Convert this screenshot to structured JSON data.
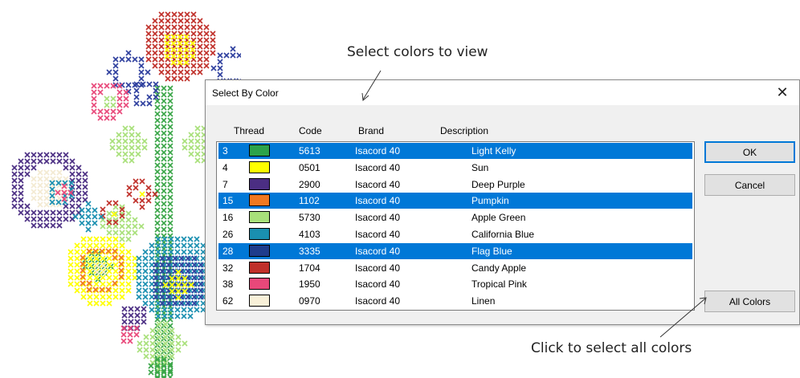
{
  "annotations": {
    "top": "Select colors to view",
    "bottom": "Click to select all colors"
  },
  "dialog": {
    "title": "Select By Color",
    "close_glyph": "✕",
    "columns": {
      "thread": "Thread",
      "code": "Code",
      "brand": "Brand",
      "description": "Description"
    },
    "rows": [
      {
        "thread": "3",
        "color": "#2ca34a",
        "code": "5613",
        "brand": "Isacord 40",
        "description": "Light Kelly",
        "selected": true
      },
      {
        "thread": "4",
        "color": "#ffff00",
        "code": "0501",
        "brand": "Isacord 40",
        "description": "Sun",
        "selected": false
      },
      {
        "thread": "7",
        "color": "#4b2e83",
        "code": "2900",
        "brand": "Isacord 40",
        "description": "Deep Purple",
        "selected": false
      },
      {
        "thread": "15",
        "color": "#f07820",
        "code": "1102",
        "brand": "Isacord 40",
        "description": "Pumpkin",
        "selected": true
      },
      {
        "thread": "16",
        "color": "#a8e07a",
        "code": "5730",
        "brand": "Isacord 40",
        "description": "Apple Green",
        "selected": false
      },
      {
        "thread": "26",
        "color": "#1a8fb0",
        "code": "4103",
        "brand": "Isacord 40",
        "description": "California Blue",
        "selected": false
      },
      {
        "thread": "28",
        "color": "#1f3c8c",
        "code": "3335",
        "brand": "Isacord 40",
        "description": "Flag Blue",
        "selected": true
      },
      {
        "thread": "32",
        "color": "#c0302a",
        "code": "1704",
        "brand": "Isacord 40",
        "description": "Candy Apple",
        "selected": false
      },
      {
        "thread": "38",
        "color": "#e8487a",
        "code": "1950",
        "brand": "Isacord 40",
        "description": "Tropical Pink",
        "selected": false
      },
      {
        "thread": "62",
        "color": "#f8f0d8",
        "code": "0970",
        "brand": "Isacord 40",
        "description": "Linen",
        "selected": false
      }
    ],
    "buttons": {
      "ok": "OK",
      "cancel": "Cancel",
      "all_colors": "All Colors"
    }
  }
}
